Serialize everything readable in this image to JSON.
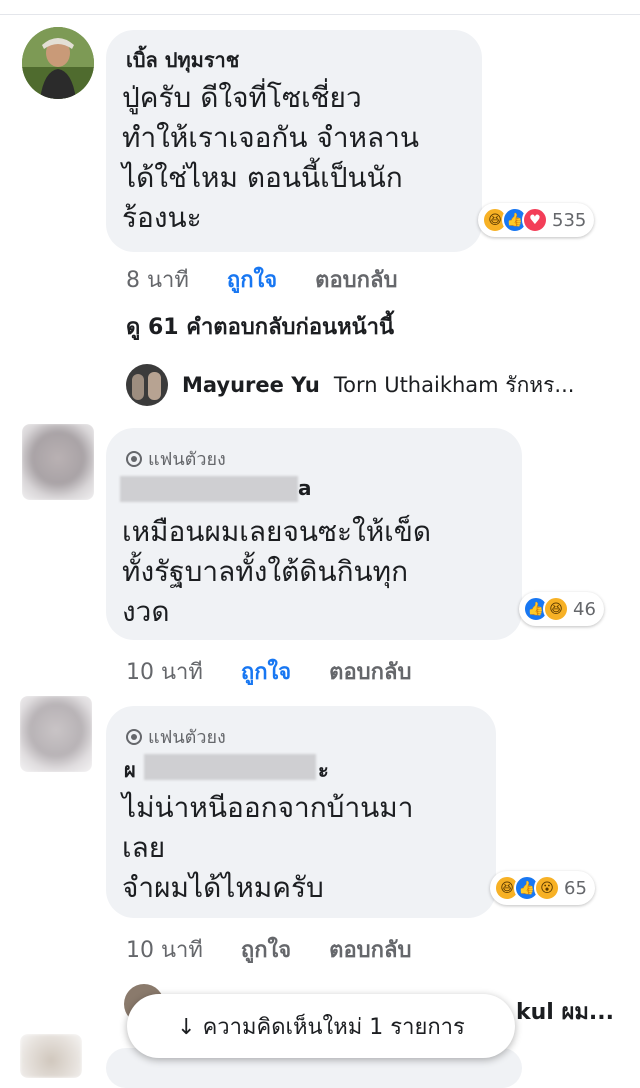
{
  "comments": [
    {
      "author": "เบิ้ล ปทุมราช",
      "text": [
        "ปู่ครับ ดีใจที่โซเชี่ยว",
        "ทำให้เราเจอกัน จำหลาน",
        "ได้ใช่ไหม ตอนนี้เป็นนัก",
        "ร้องนะ"
      ],
      "reactions": [
        "haha-icon",
        "like-icon",
        "love-icon"
      ],
      "reaction_count": "535",
      "time": "8 นาที",
      "like_label": "ถูกใจ",
      "reply_label": "ตอบกลับ"
    },
    {
      "badge": "แฟนตัวยง",
      "author_visible": "a",
      "text": [
        "เหมือนผมเลยจนซะให้เข็ด",
        "ทั้งรัฐบาลทั้งใต้ดินกินทุก",
        "งวด"
      ],
      "reactions": [
        "like-icon",
        "haha-icon"
      ],
      "reaction_count": "46",
      "time": "10 นาที",
      "like_label": "ถูกใจ",
      "reply_label": "ตอบกลับ"
    },
    {
      "badge": "แฟนตัวยง",
      "author_visible_left": "ผ",
      "author_visible_right": "ะ",
      "text": [
        "ไม่น่าหนีออกจากบ้านมา",
        "เลย",
        "จำผมได้ไหมครับ"
      ],
      "reactions": [
        "haha-icon",
        "like-icon",
        "wow-icon"
      ],
      "reaction_count": "65",
      "time": "10 นาที",
      "like_label": "ถูกใจ",
      "reply_label": "ตอบกลับ"
    }
  ],
  "previous_replies": "ดู 61 คำตอบกลับก่อนหน้านี้",
  "reply_preview": {
    "name": "Mayuree Yu",
    "text": "Torn Uthaikham รักหร..."
  },
  "peek": {
    "text": "kul ผม..."
  },
  "new_comments_pill": "↓ ความคิดเห็นใหม่ 1 รายการ",
  "colors": {
    "bubble": "#f0f2f5",
    "link_blue": "#1877f2",
    "meta_gray": "#65676b"
  }
}
